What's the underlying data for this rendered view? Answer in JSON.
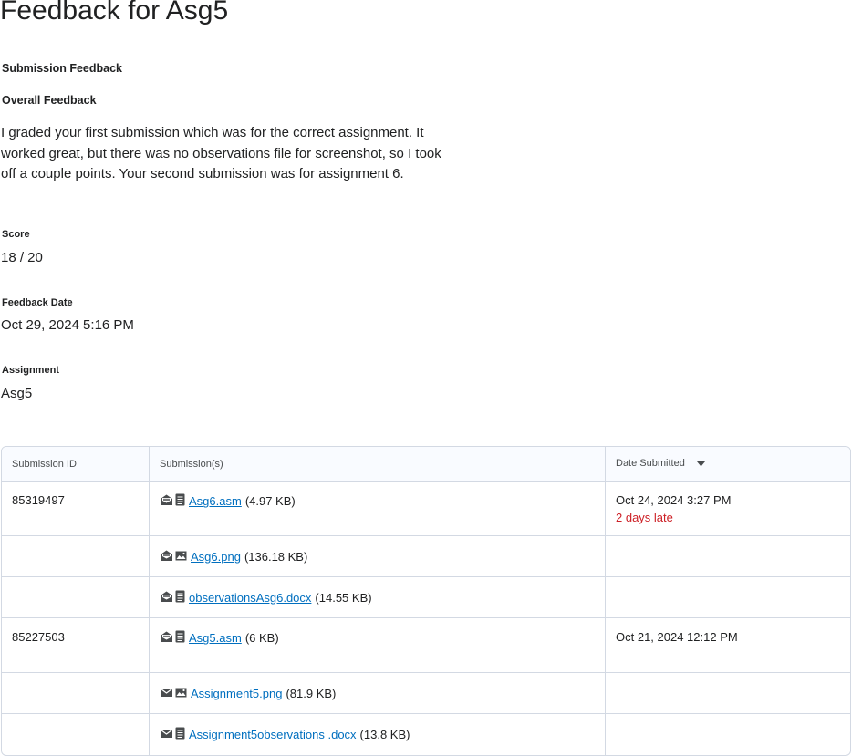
{
  "page": {
    "title": "Feedback for Asg5"
  },
  "feedback": {
    "submission_feedback_heading": "Submission Feedback",
    "overall_feedback_heading": "Overall Feedback",
    "overall_feedback_text": "I graded your first submission which was for the correct assignment.  It worked great, but there was no observations file for screenshot, so I took off a couple points.  Your second submission was for assignment 6.",
    "score_label": "Score",
    "score_value": "18 / 20",
    "feedback_date_label": "Feedback Date",
    "feedback_date_value": "Oct 29, 2024 5:16 PM",
    "assignment_label": "Assignment",
    "assignment_value": "Asg5"
  },
  "table": {
    "headers": {
      "submission_id": "Submission ID",
      "submissions": "Submission(s)",
      "date_submitted": "Date Submitted"
    },
    "rows": [
      {
        "id": "85319497",
        "file": "Asg6.asm",
        "size": "(4.97 KB)",
        "icon1": "envelope-open-icon",
        "icon2": "document-icon",
        "date": "Oct 24, 2024 3:27 PM",
        "late": "2 days late"
      },
      {
        "id": "",
        "file": "Asg6.png",
        "size": "(136.18 KB)",
        "icon1": "envelope-open-icon",
        "icon2": "image-icon",
        "date": "",
        "late": ""
      },
      {
        "id": "",
        "file": "observationsAsg6.docx",
        "size": "(14.55 KB)",
        "icon1": "envelope-open-icon",
        "icon2": "document-icon",
        "date": "",
        "late": ""
      },
      {
        "id": "85227503",
        "file": "Asg5.asm",
        "size": "(6 KB)",
        "icon1": "envelope-open-icon",
        "icon2": "document-icon",
        "date": "Oct 21, 2024 12:12 PM",
        "late": ""
      },
      {
        "id": "",
        "file": "Assignment5.png",
        "size": "(81.9 KB)",
        "icon1": "envelope-icon",
        "icon2": "image-icon",
        "date": "",
        "late": ""
      },
      {
        "id": "",
        "file": "Assignment5observations .docx",
        "size": "(13.8 KB)",
        "icon1": "envelope-icon",
        "icon2": "document-icon",
        "date": "",
        "late": ""
      }
    ]
  },
  "colors": {
    "link": "#006fbf",
    "late": "#cd2026",
    "border": "#d3d9e3"
  }
}
